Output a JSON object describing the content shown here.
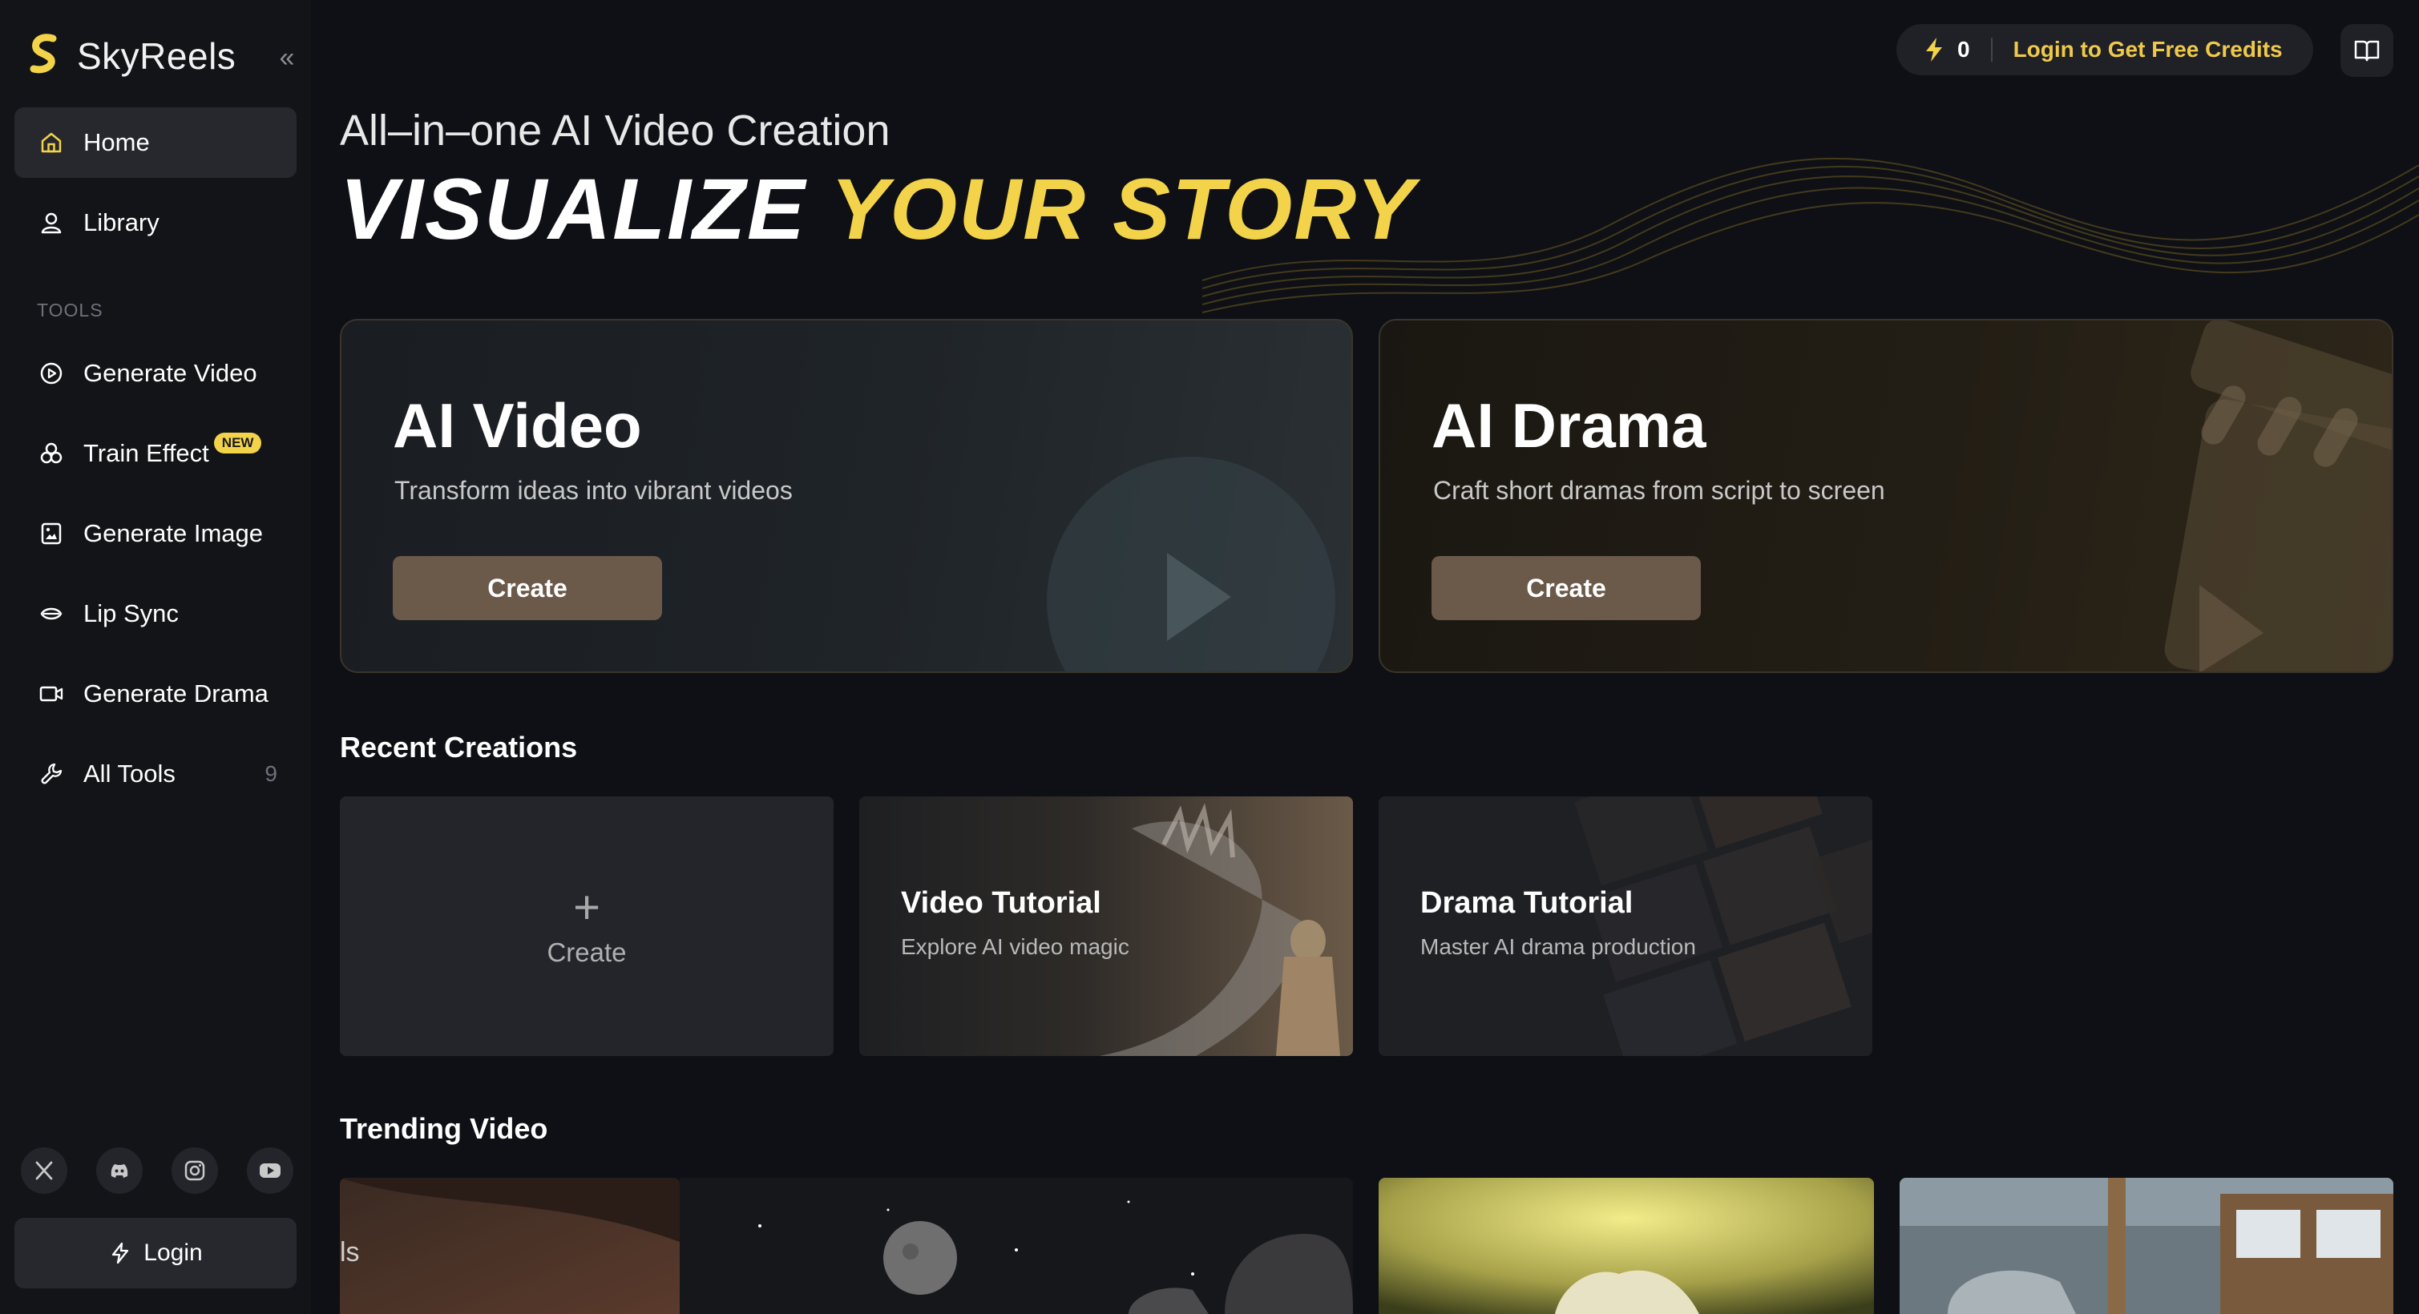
{
  "app": {
    "name": "SkyReels"
  },
  "sidebar": {
    "items": [
      {
        "label": "Home",
        "icon": "home-icon",
        "active": true
      },
      {
        "label": "Library",
        "icon": "user-icon"
      }
    ],
    "tools_label": "TOOLS",
    "tools": [
      {
        "label": "Generate Video",
        "icon": "play-circle-icon"
      },
      {
        "label": "Train Effect",
        "icon": "train-effect-icon",
        "badge": "NEW"
      },
      {
        "label": "Generate Image",
        "icon": "image-icon"
      },
      {
        "label": "Lip Sync",
        "icon": "lips-icon"
      },
      {
        "label": "Generate Drama",
        "icon": "camera-icon"
      },
      {
        "label": "All Tools",
        "icon": "wrench-icon",
        "count": "9"
      }
    ],
    "social": [
      "x-icon",
      "discord-icon",
      "instagram-icon",
      "youtube-icon"
    ],
    "login_label": "Login"
  },
  "topbar": {
    "credit_count": "0",
    "credit_link": "Login to Get Free Credits"
  },
  "hero": {
    "subtitle": "All–in–one AI Video Creation",
    "headline_white": "VISUALIZE ",
    "headline_gold": "YOUR STORY"
  },
  "features": [
    {
      "title": "AI Video",
      "desc": "Transform ideas into vibrant videos",
      "button": "Create"
    },
    {
      "title": "AI Drama",
      "desc": "Craft short dramas from script to screen",
      "button": "Create"
    }
  ],
  "recent": {
    "title": "Recent Creations",
    "create_label": "Create",
    "cards": [
      {
        "title": "Video Tutorial",
        "subtitle": "Explore AI video magic"
      },
      {
        "title": "Drama Tutorial",
        "subtitle": "Master AI drama production"
      }
    ]
  },
  "trending": {
    "title": "Trending Video",
    "partial_caption": "ls"
  },
  "colors": {
    "accent": "#f3d34a",
    "button": "#6b5a4a",
    "background": "#0e1015"
  }
}
